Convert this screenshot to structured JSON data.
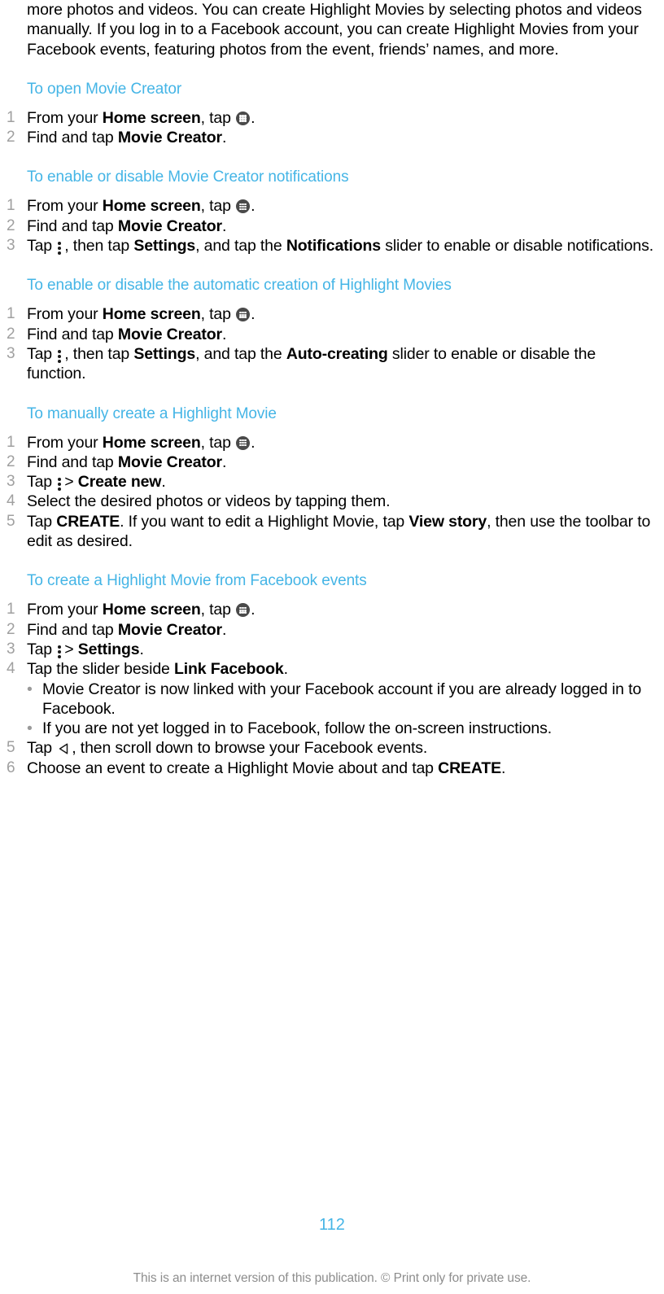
{
  "document": {
    "intro_paragraph": "more photos and videos. You can create Highlight Movies by selecting photos and videos manually. If you log in to a Facebook account, you can create Highlight Movies from your Facebook events, featuring photos from the event, friends’ names, and more.",
    "page_number": "112",
    "footer_text": "This is an internet version of this publication. © Print only for private use.",
    "colors": {
      "heading_blue": "#45b5e6",
      "body_black": "#000000",
      "list_number_gray": "#a0a0a0",
      "footer_gray": "#8d8d8d"
    }
  },
  "sections": [
    {
      "heading": "To open Movie Creator",
      "steps": [
        {
          "num": "1",
          "parts": [
            {
              "t": "From your ",
              "style": "normal"
            },
            {
              "t": "Home screen",
              "style": "bold"
            },
            {
              "t": ", tap ",
              "style": "normal"
            },
            {
              "t": "app-drawer-icon",
              "style": "icon"
            },
            {
              "t": ".",
              "style": "normal"
            }
          ]
        },
        {
          "num": "2",
          "parts": [
            {
              "t": "Find and tap ",
              "style": "normal"
            },
            {
              "t": "Movie Creator",
              "style": "bold"
            },
            {
              "t": ".",
              "style": "normal"
            }
          ]
        }
      ]
    },
    {
      "heading": "To enable or disable Movie Creator notifications",
      "steps": [
        {
          "num": "1",
          "parts": [
            {
              "t": "From your ",
              "style": "normal"
            },
            {
              "t": "Home screen",
              "style": "bold"
            },
            {
              "t": ", tap ",
              "style": "normal"
            },
            {
              "t": "app-drawer-icon",
              "style": "icon"
            },
            {
              "t": ".",
              "style": "normal"
            }
          ]
        },
        {
          "num": "2",
          "parts": [
            {
              "t": "Find and tap ",
              "style": "normal"
            },
            {
              "t": "Movie Creator",
              "style": "bold"
            },
            {
              "t": ".",
              "style": "normal"
            }
          ]
        },
        {
          "num": "3",
          "parts": [
            {
              "t": "Tap ",
              "style": "normal"
            },
            {
              "t": "kebab-menu-icon",
              "style": "icon"
            },
            {
              "t": ", then tap ",
              "style": "normal"
            },
            {
              "t": "Settings",
              "style": "bold"
            },
            {
              "t": ", and tap the ",
              "style": "normal"
            },
            {
              "t": "Notifications",
              "style": "bold"
            },
            {
              "t": " slider to enable or disable notifications.",
              "style": "normal"
            }
          ]
        }
      ]
    },
    {
      "heading": "To enable or disable the automatic creation of Highlight Movies",
      "steps": [
        {
          "num": "1",
          "parts": [
            {
              "t": "From your ",
              "style": "normal"
            },
            {
              "t": "Home screen",
              "style": "bold"
            },
            {
              "t": ", tap ",
              "style": "normal"
            },
            {
              "t": "app-drawer-icon",
              "style": "icon"
            },
            {
              "t": ".",
              "style": "normal"
            }
          ]
        },
        {
          "num": "2",
          "parts": [
            {
              "t": "Find and tap ",
              "style": "normal"
            },
            {
              "t": "Movie Creator",
              "style": "bold"
            },
            {
              "t": ".",
              "style": "normal"
            }
          ]
        },
        {
          "num": "3",
          "parts": [
            {
              "t": "Tap ",
              "style": "normal"
            },
            {
              "t": "kebab-menu-icon",
              "style": "icon"
            },
            {
              "t": ", then tap ",
              "style": "normal"
            },
            {
              "t": "Settings",
              "style": "bold"
            },
            {
              "t": ", and tap the ",
              "style": "normal"
            },
            {
              "t": "Auto-creating",
              "style": "bold"
            },
            {
              "t": " slider to enable or disable the function.",
              "style": "normal"
            }
          ]
        }
      ]
    },
    {
      "heading": "To manually create a Highlight Movie",
      "steps": [
        {
          "num": "1",
          "parts": [
            {
              "t": "From your ",
              "style": "normal"
            },
            {
              "t": "Home screen",
              "style": "bold"
            },
            {
              "t": ", tap ",
              "style": "normal"
            },
            {
              "t": "app-drawer-icon",
              "style": "icon"
            },
            {
              "t": ".",
              "style": "normal"
            }
          ]
        },
        {
          "num": "2",
          "parts": [
            {
              "t": "Find and tap ",
              "style": "normal"
            },
            {
              "t": "Movie Creator",
              "style": "bold"
            },
            {
              "t": ".",
              "style": "normal"
            }
          ]
        },
        {
          "num": "3",
          "parts": [
            {
              "t": "Tap ",
              "style": "normal"
            },
            {
              "t": "kebab-menu-icon",
              "style": "icon"
            },
            {
              "t": "> ",
              "style": "normal"
            },
            {
              "t": "Create new",
              "style": "bold"
            },
            {
              "t": ".",
              "style": "normal"
            }
          ]
        },
        {
          "num": "4",
          "parts": [
            {
              "t": "Select the desired photos or videos by tapping them.",
              "style": "normal"
            }
          ]
        },
        {
          "num": "5",
          "parts": [
            {
              "t": "Tap ",
              "style": "normal"
            },
            {
              "t": "CREATE",
              "style": "bold"
            },
            {
              "t": ". If you want to edit a Highlight Movie, tap ",
              "style": "normal"
            },
            {
              "t": "View story",
              "style": "bold"
            },
            {
              "t": ", then use the toolbar to edit as desired.",
              "style": "normal"
            }
          ]
        }
      ]
    },
    {
      "heading": "To create a Highlight Movie from Facebook events",
      "steps": [
        {
          "num": "1",
          "parts": [
            {
              "t": "From your ",
              "style": "normal"
            },
            {
              "t": "Home screen",
              "style": "bold"
            },
            {
              "t": ", tap ",
              "style": "normal"
            },
            {
              "t": "app-drawer-icon",
              "style": "icon"
            },
            {
              "t": ".",
              "style": "normal"
            }
          ]
        },
        {
          "num": "2",
          "parts": [
            {
              "t": "Find and tap ",
              "style": "normal"
            },
            {
              "t": "Movie Creator",
              "style": "bold"
            },
            {
              "t": ".",
              "style": "normal"
            }
          ]
        },
        {
          "num": "3",
          "parts": [
            {
              "t": "Tap ",
              "style": "normal"
            },
            {
              "t": "kebab-menu-icon",
              "style": "icon"
            },
            {
              "t": "> ",
              "style": "normal"
            },
            {
              "t": "Settings",
              "style": "bold"
            },
            {
              "t": ".",
              "style": "normal"
            }
          ]
        },
        {
          "num": "4",
          "parts": [
            {
              "t": "Tap the slider beside ",
              "style": "normal"
            },
            {
              "t": "Link Facebook",
              "style": "bold"
            },
            {
              "t": ".",
              "style": "normal"
            }
          ],
          "subbullets": [
            "Movie Creator is now linked with your Facebook account if you are already logged in to Facebook.",
            "If you are not yet logged in to Facebook, follow the on-screen instructions."
          ]
        },
        {
          "num": "5",
          "parts": [
            {
              "t": "Tap ",
              "style": "normal"
            },
            {
              "t": "back-arrow-icon",
              "style": "icon"
            },
            {
              "t": ", then scroll down to browse your Facebook events.",
              "style": "normal"
            }
          ]
        },
        {
          "num": "6",
          "parts": [
            {
              "t": "Choose an event to create a Highlight Movie about and tap ",
              "style": "normal"
            },
            {
              "t": "CREATE",
              "style": "bold"
            },
            {
              "t": ".",
              "style": "normal"
            }
          ]
        }
      ]
    }
  ]
}
